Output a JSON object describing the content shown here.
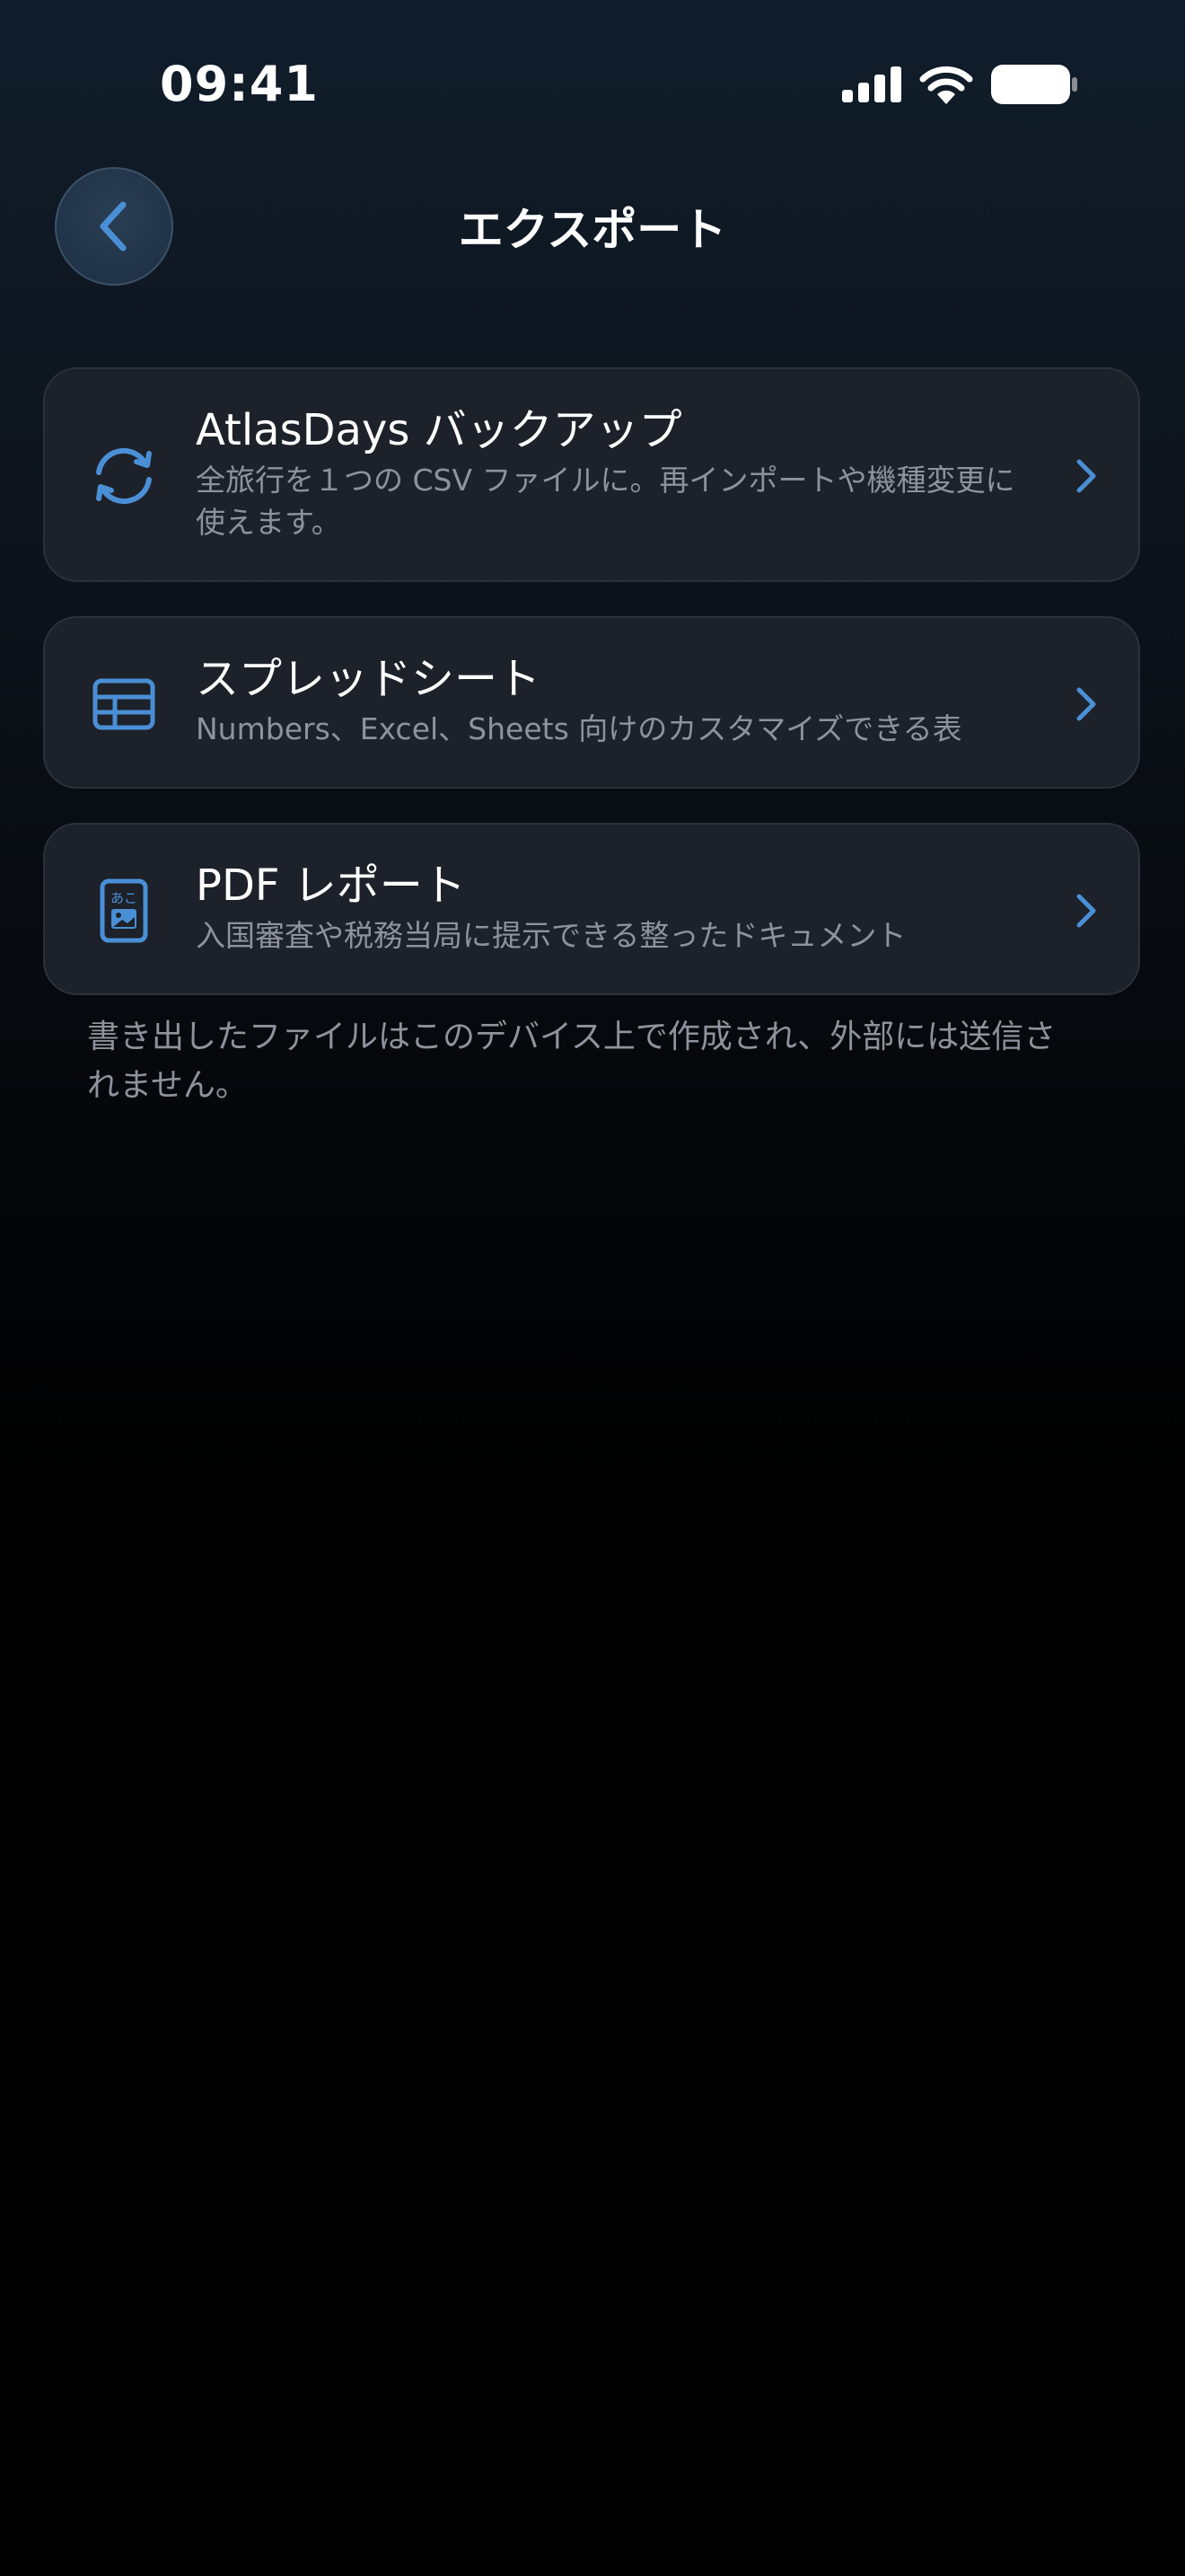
{
  "status_bar": {
    "time": "09:41"
  },
  "nav": {
    "title": "エクスポート",
    "back_icon": "chevron-left-icon"
  },
  "options": [
    {
      "icon": "sync-icon",
      "title": "AtlasDays バックアップ",
      "subtitle": "全旅行を１つの CSV ファイルに。再インポートや機種変更に使えます。"
    },
    {
      "icon": "table-icon",
      "title": "スプレッドシート",
      "subtitle": "Numbers、Excel、Sheets 向けのカスタマイズできる表"
    },
    {
      "icon": "document-icon",
      "title": "PDF レポート",
      "subtitle": "入国審査や税務当局に提示できる整ったドキュメント"
    }
  ],
  "footnote": "書き出したファイルはこのデバイス上で作成され、外部には送信されません。",
  "colors": {
    "accent": "#4a8fd6",
    "card_bg": "#1d2129",
    "secondary_text": "#8d939c"
  }
}
